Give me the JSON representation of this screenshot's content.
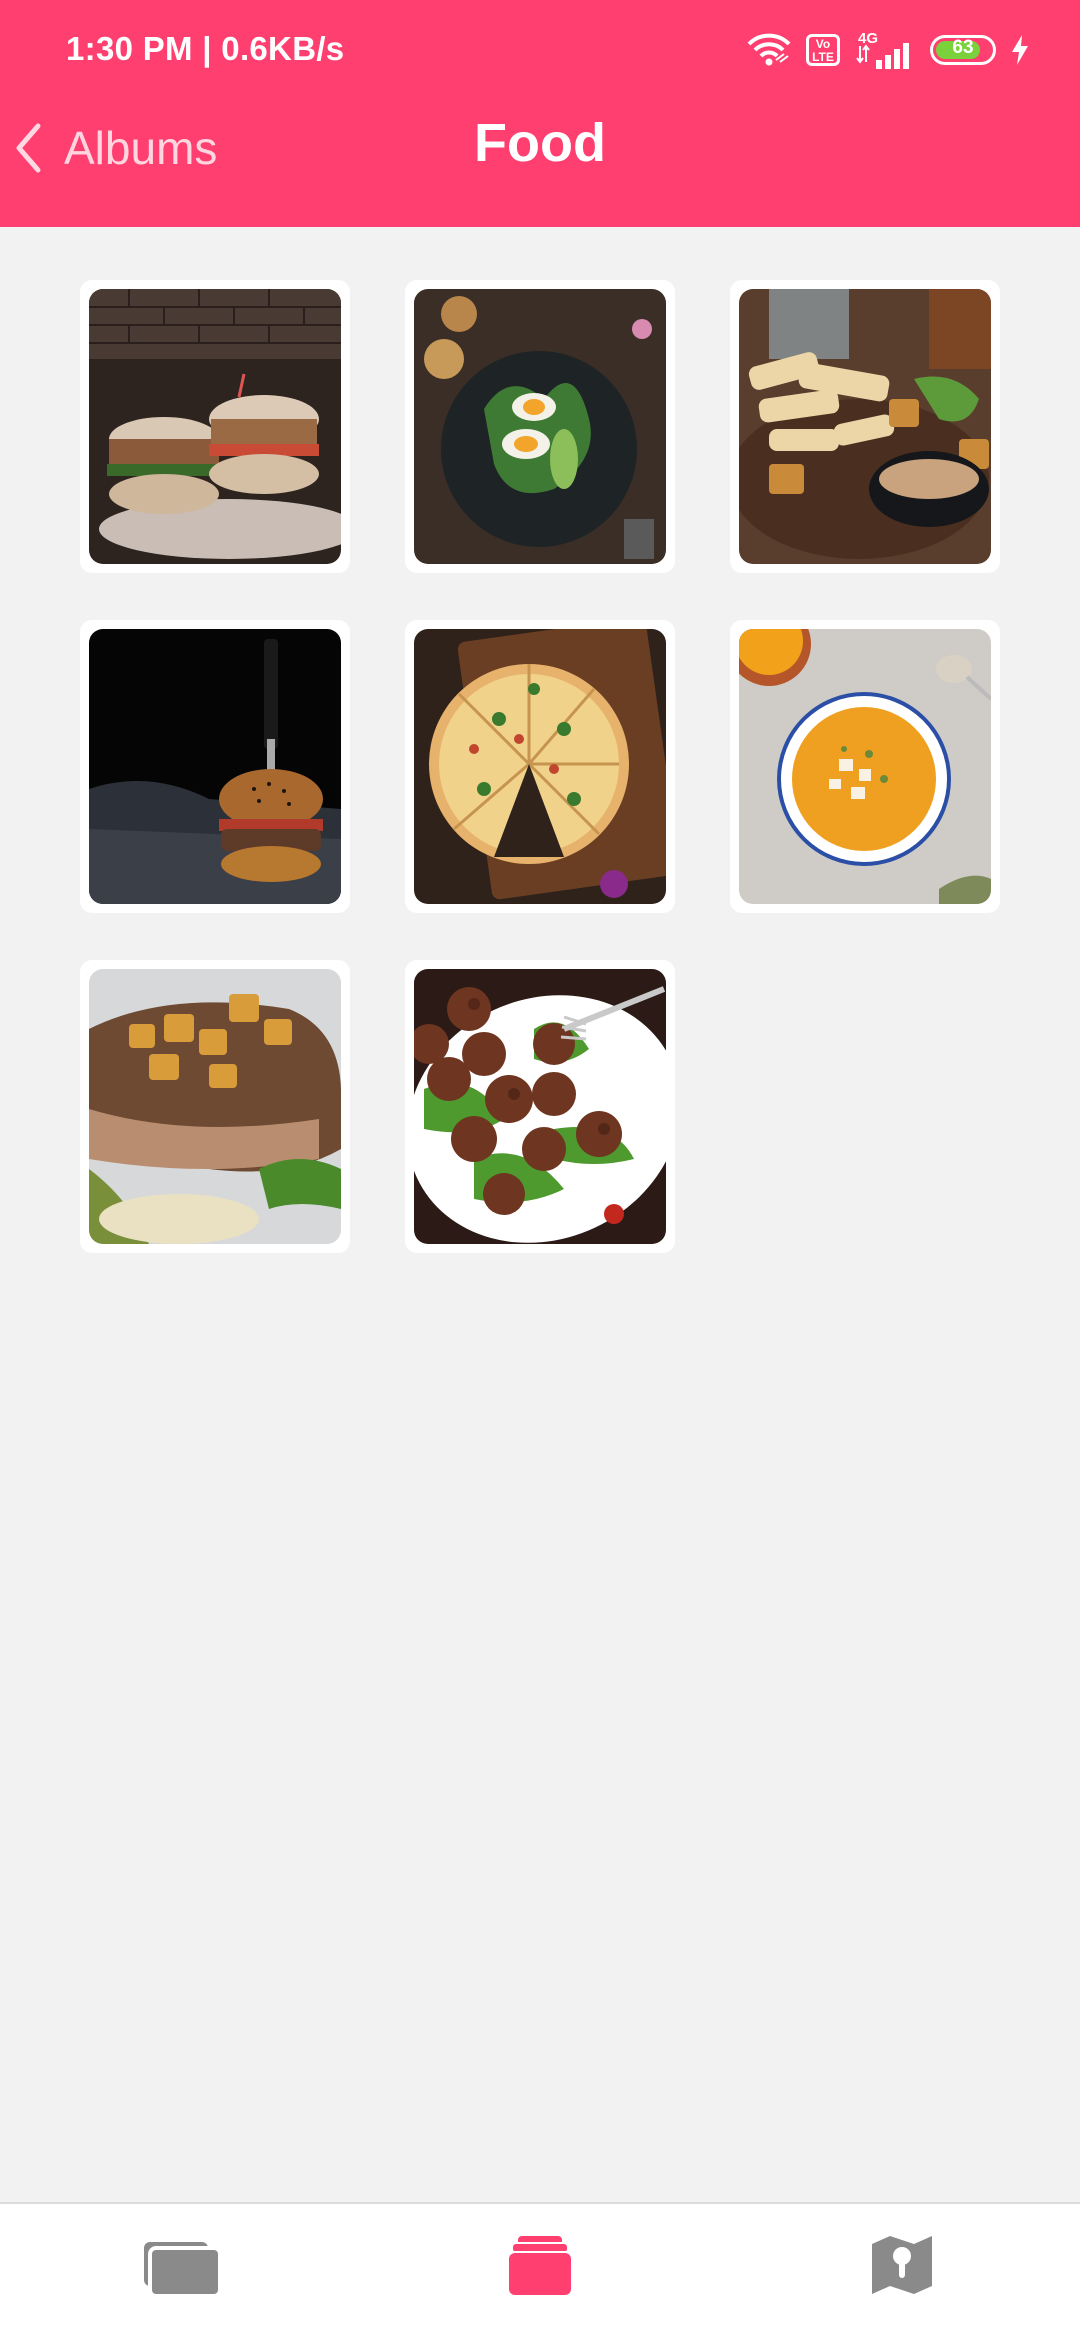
{
  "status_bar": {
    "time": "1:30 PM | 0.6KB/s",
    "volte": "Vo LTE",
    "network": "4G",
    "battery": "63"
  },
  "header": {
    "back_label": "Albums",
    "title": "Food",
    "color": "#ff3f6f"
  },
  "photos": [
    {
      "name": "photo-burgers-pair",
      "icon": "burger"
    },
    {
      "name": "photo-egg-salad",
      "icon": "egg-salad"
    },
    {
      "name": "photo-grilled-platter",
      "icon": "platter"
    },
    {
      "name": "photo-knife-burger",
      "icon": "burger"
    },
    {
      "name": "photo-pizza",
      "icon": "pizza"
    },
    {
      "name": "photo-pumpkin-soup",
      "icon": "soup"
    },
    {
      "name": "photo-pork-chop",
      "icon": "pork-chop"
    },
    {
      "name": "photo-meatballs",
      "icon": "meatballs"
    }
  ],
  "tab_bar": {
    "tabs": [
      {
        "name": "photos-tab",
        "icon": "photos-stack-icon",
        "active": false
      },
      {
        "name": "albums-tab",
        "icon": "albums-icon",
        "active": true
      },
      {
        "name": "places-tab",
        "icon": "map-pin-icon",
        "active": false
      }
    ],
    "active_color": "#ff3f6f",
    "inactive_color": "#8a8a8a"
  }
}
